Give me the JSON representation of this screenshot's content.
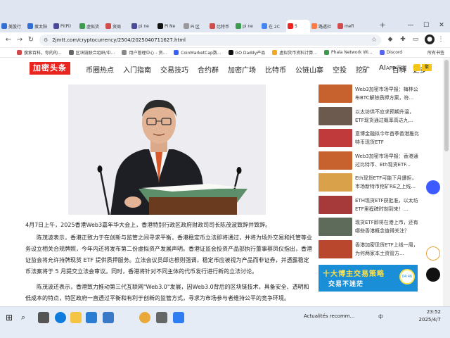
{
  "browser": {
    "tabs": [
      {
        "label": "美股行",
        "color": "#2f6fd6"
      },
      {
        "label": "蛋太阳",
        "color": "#2f6fd6"
      },
      {
        "label": "Pi(Pi)",
        "color": "#4a4a9c"
      },
      {
        "label": "虚拟货",
        "color": "#3c9b4c"
      },
      {
        "label": "资周",
        "color": "#d24b4b"
      },
      {
        "label": "pi ne",
        "color": "#4a4a9c"
      },
      {
        "label": "Pi Ne",
        "color": "#111111"
      },
      {
        "label": "Pi 区",
        "color": "#999999"
      },
      {
        "label": "比特币",
        "color": "#d24b4b"
      },
      {
        "label": "pi ne",
        "color": "#3c9b4c"
      },
      {
        "label": "在 2C",
        "color": "#4285f4"
      },
      {
        "label": "5",
        "color": "#e8251f"
      },
      {
        "label": "路透社",
        "color": "#ff7a45"
      },
      {
        "label": "mefi",
        "color": "#d24b4b"
      }
    ],
    "new_tab": "+",
    "window_controls": {
      "minimize": "—",
      "maximize": "☐",
      "close": "✕"
    },
    "url": "2jmtt.com/cryptocurrency/2504/2025040711627.html",
    "bookmarks": [
      {
        "label": "搜索百科，你的的...",
        "color": "#d24b4b"
      },
      {
        "label": "区块链联合组织/中...",
        "color": "#666666"
      },
      {
        "label": "用户管理中心 - 资...",
        "color": "#888888"
      },
      {
        "label": "CoinMarketCap数...",
        "color": "#3861fb"
      },
      {
        "label": "GO Daddy产品",
        "color": "#111111"
      },
      {
        "label": "虚拟货币资料计算...",
        "color": "#f5a623"
      },
      {
        "label": "Phala Network Wi...",
        "color": "#3c9b4c"
      },
      {
        "label": "Discord",
        "color": "#5865f2"
      }
    ],
    "all_bookmarks": "所有书签"
  },
  "site": {
    "logo": "加密头条",
    "nav": [
      "币圈热点",
      "入门指南",
      "交易技巧",
      "合约群",
      "加密广场",
      "比特币",
      "公链山寨",
      "空投",
      "挖矿",
      "AI",
      "百科",
      "更多"
    ],
    "app_label": "APP 下载"
  },
  "article": {
    "paragraphs": [
      "4月7日上午，2025香港Web3嘉年华大会上，香港特别行政区政府财政司司长陈茂波致辞并致辞。",
      "陈茂波表示，香港正致力于在创新与监管之间寻求平衡，香港稳定币立法即将通过，并将为场外交易和托管等业务设立相关合规牌照，今年内还将发布第二份虚拟资产发展声明。香港证监会投资产品部执行董事蔡凤仪指出，香港证监会将允许持牌现货 ETF 提供质押服务。立法会议员邱达根则强调，稳定币应被视为产品而非证券，并透露稳定币法案将于 5 月提交立法会审议。同时，香港将针对不同主体的代币发行进行新的立法讨论。",
      "陈茂波还表示，香港致力推动第三代互联网\"Web3.0\"发展，因Web3.0背后的区块链技术，具备安全、透明和低成本的特点，特区政府一直透过平衡和有利于创新的监管方式，寻求为市场参与者维持公平的竞争环境。"
    ]
  },
  "sidebar": {
    "items": [
      {
        "text": "Web3加密市场早报：梅林公布BTC解除质押方案，符...",
        "color": "#c7612d"
      },
      {
        "text": "以太坊供不应求预期升温，ETF现货通过概率高达九...",
        "color": "#6b5a4d"
      },
      {
        "text": "意博金融拟今年首季香港推比特币现货ETF",
        "color": "#c0393b"
      },
      {
        "text": "Web3加密市场早报：香港通过比特币、Eth现货ETF...",
        "color": "#c7612d"
      },
      {
        "text": "Eth现货ETF可能下月遭拒，市场新特币挖矿RE之上线...",
        "color": "#d9a24a"
      },
      {
        "text": "ETH现货ETF获批准，以太坊ETF里程碑时刻到来！...",
        "color": "#a63a3a"
      },
      {
        "text": "现货ETF即将在港上市，还有哪些香港概念值得关注？",
        "color": "#5f6b5a"
      },
      {
        "text": "香港加密现货ETF上线一周，为何两家本土资管方...",
        "color": "#b8472e"
      }
    ],
    "banner": {
      "line1": "十大博主交易策略",
      "line2": "交易不迷茫",
      "clock": "04:46"
    }
  },
  "taskbar": {
    "weather": "Actualités recomm...",
    "tray": "中",
    "time": "23:52",
    "date": "2025/4/7"
  }
}
